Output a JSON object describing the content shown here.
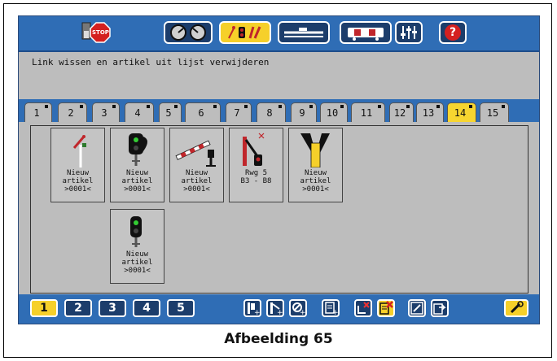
{
  "toolbar": {
    "stop_label": "STOP",
    "help_label": "?"
  },
  "message": "Link wissen en artikel uit lijst verwijderen",
  "tabs": [
    "1",
    "2",
    "3",
    "4",
    "5",
    "6",
    "7",
    "8",
    "9",
    "10",
    "11",
    "12",
    "13",
    "14",
    "15"
  ],
  "active_tab": "14",
  "articles": [
    {
      "label": "Nieuw\nartikel\n>0001<",
      "icon": "semaphore-signal-icon"
    },
    {
      "label": "Nieuw\nartikel\n>0001<",
      "icon": "light-signal-icon"
    },
    {
      "label": "Nieuw\nartikel\n>0001<",
      "icon": "level-crossing-icon"
    },
    {
      "label": "Rwg 5\nB3 - B8",
      "icon": "turnout-signal-icon"
    },
    {
      "label": "Nieuw\nartikel\n>0001<",
      "icon": "track-switch-icon"
    },
    {
      "label": "Nieuw\nartikel\n>0001<",
      "icon": "dwarf-signal-icon"
    }
  ],
  "pages": [
    "1",
    "2",
    "3",
    "4",
    "5"
  ],
  "active_page": "1",
  "caption": "Afbeelding 65",
  "colors": {
    "accent": "#f6d02a",
    "toolbar": "#2f6db5",
    "panel": "#bdbdbd"
  }
}
